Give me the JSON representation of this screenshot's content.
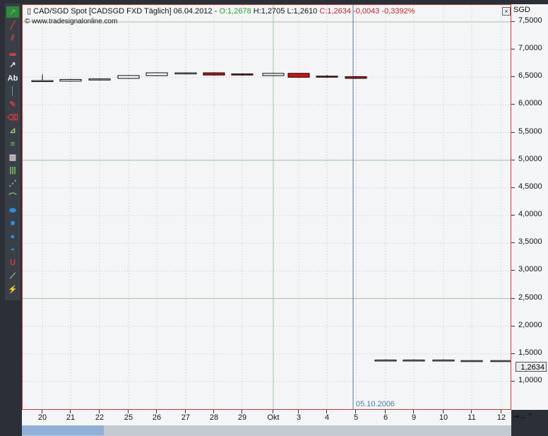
{
  "header": {
    "instrument": "CAD/SGD Spot [CADSGD FXD  Täglich] 06.04.2012 -",
    "open": "O:1,2678",
    "high": "H:1,2705",
    "low": "L:1,2610",
    "close_info": "C:1,2634 -0,0043 -0,3392%",
    "website": "www.tradesignalonline.com",
    "close_button": "×"
  },
  "currency": "SGD",
  "last_price_label": "1,2634",
  "vertical_line_label": "05.10.2006",
  "nav_buttons": "⇥↔⌃",
  "colors": {
    "up": "#ffffff",
    "down": "#dd1111",
    "grid": "#9fc79f",
    "cursor": "#4b7fa0"
  },
  "toolbar_icons": [
    "cursor-arrow-icon",
    "line-icon",
    "parallel-lines-icon",
    "horizontal-line-icon",
    "arrow-icon",
    "text-icon",
    "vertical-line-icon",
    "pen-icon",
    "eraser-icon",
    "gann-icon",
    "fibonacci-icon",
    "time-icon",
    "time-zones-icon",
    "fan-icon",
    "arc-icon",
    "ellipse-icon",
    "rectangle-icon",
    "circle-icon",
    "semicircle-icon",
    "magnet-icon",
    "snap-icon",
    "delete-icon"
  ],
  "chart_data": {
    "type": "candlestick",
    "ylim": [
      0.5,
      7.7
    ],
    "yticks": [
      {
        "v": 7.5,
        "label": "7,5000"
      },
      {
        "v": 7.0,
        "label": "7,0000"
      },
      {
        "v": 6.5,
        "label": "6,5000"
      },
      {
        "v": 6.0,
        "label": "6,0000"
      },
      {
        "v": 5.5,
        "label": "5,5000"
      },
      {
        "v": 5.0,
        "label": "5,0000"
      },
      {
        "v": 4.5,
        "label": "4,5000"
      },
      {
        "v": 4.0,
        "label": "4,0000"
      },
      {
        "v": 3.5,
        "label": "3,5000"
      },
      {
        "v": 3.0,
        "label": "3,0000"
      },
      {
        "v": 2.5,
        "label": "2,5000"
      },
      {
        "v": 2.0,
        "label": "2,0000"
      },
      {
        "v": 1.5,
        "label": "1,5000"
      },
      {
        "v": 1.0,
        "label": "1,0000"
      }
    ],
    "grid_major": [
      7.5,
      5.0,
      2.5
    ],
    "x_labels": [
      "20",
      "21",
      "22",
      "25",
      "26",
      "27",
      "28",
      "29",
      "Okt",
      "3",
      "4",
      "5",
      "6",
      "9",
      "10",
      "11",
      "12"
    ],
    "candles": [
      {
        "o": 6.43,
        "h": 6.55,
        "l": 6.43,
        "c": 6.44
      },
      {
        "o": 6.43,
        "h": 6.47,
        "l": 6.42,
        "c": 6.46
      },
      {
        "o": 6.45,
        "h": 6.48,
        "l": 6.44,
        "c": 6.47
      },
      {
        "o": 6.48,
        "h": 6.54,
        "l": 6.47,
        "c": 6.53
      },
      {
        "o": 6.53,
        "h": 6.59,
        "l": 6.52,
        "c": 6.58
      },
      {
        "o": 6.56,
        "h": 6.59,
        "l": 6.55,
        "c": 6.58
      },
      {
        "o": 6.58,
        "h": 6.59,
        "l": 6.53,
        "c": 6.54
      },
      {
        "o": 6.56,
        "h": 6.57,
        "l": 6.53,
        "c": 6.54
      },
      {
        "o": 6.53,
        "h": 6.58,
        "l": 6.52,
        "c": 6.57
      },
      {
        "o": 6.57,
        "h": 6.57,
        "l": 6.49,
        "c": 6.5
      },
      {
        "o": 6.52,
        "h": 6.54,
        "l": 6.49,
        "c": 6.51
      },
      {
        "o": 6.51,
        "h": 6.52,
        "l": 6.47,
        "c": 6.48
      },
      {
        "o": 1.39,
        "h": 1.4,
        "l": 1.39,
        "c": 1.39
      },
      {
        "o": 1.39,
        "h": 1.4,
        "l": 1.39,
        "c": 1.39
      },
      {
        "o": 1.39,
        "h": 1.4,
        "l": 1.39,
        "c": 1.39
      },
      {
        "o": 1.38,
        "h": 1.39,
        "l": 1.38,
        "c": 1.38
      },
      {
        "o": 1.38,
        "h": 1.38,
        "l": 1.38,
        "c": 1.38
      }
    ],
    "vertical_line_index": 11
  }
}
